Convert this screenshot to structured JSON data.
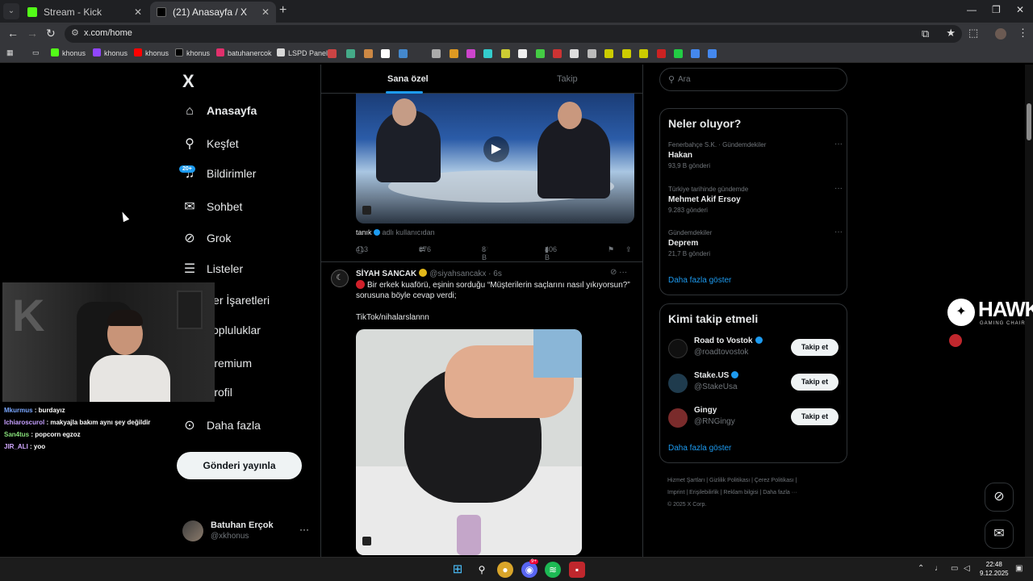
{
  "browser": {
    "tabs": [
      {
        "label": "Stream - Kick Dashboard",
        "favicon_color": "#53fc18"
      },
      {
        "label": "(21) Anasayfa / X",
        "favicon_color": "#000000"
      }
    ],
    "url": "x.com/home",
    "bookmarks": [
      "khonus",
      "khonus",
      "khonus",
      "khonus",
      "batuhanercok",
      "LSPD Panel"
    ]
  },
  "x": {
    "logo": "X",
    "nav": [
      {
        "label": "Anasayfa",
        "icon": "home-icon"
      },
      {
        "label": "Keşfet",
        "icon": "search-icon"
      },
      {
        "label": "Bildirimler",
        "icon": "bell-icon"
      },
      {
        "label": "Sohbet",
        "icon": "mail-icon"
      },
      {
        "label": "Grok",
        "icon": "grok-icon"
      },
      {
        "label": "Listeler",
        "icon": "list-icon"
      },
      {
        "label": "Yer İşaretleri",
        "icon": "bookmark-icon"
      },
      {
        "label": "Topluluklar",
        "icon": "communities-icon"
      },
      {
        "label": "Premium",
        "icon": "premium-icon"
      },
      {
        "label": "Profil",
        "icon": "profile-icon"
      },
      {
        "label": "Daha fazla",
        "icon": "more-icon"
      }
    ],
    "notif_badge": "20+",
    "post_button": "Gönderi yayınla",
    "account": {
      "name": "Batuhan Erçok",
      "handle": "@xkhonus",
      "more": "···"
    }
  },
  "timeline": {
    "tabs": [
      "Sana özel",
      "Takip"
    ],
    "post1": {
      "source_name": "tanık",
      "source_suffix": "adlı kullanıcıdan",
      "replies": "413",
      "reposts": "676",
      "likes": "8 B",
      "views": "406 B"
    },
    "post2": {
      "name": "SİYAH SANCAK",
      "handle": "@siyahsancakx · 6s",
      "text": "Bir erkek kuaförü, eşinin sorduğu “Müşterilerin saçlarını nasıl yıkıyorsun?” sorusuna böyle cevap verdi;",
      "tag": "TikTok/nihalarslannn"
    }
  },
  "sidebar": {
    "search_placeholder": "Ara",
    "trends_title": "Neler oluyor?",
    "trends": [
      {
        "context": "Fenerbahçe S.K. · Gündemdekiler",
        "title": "Hakan",
        "count": "93,9 B gönderi"
      },
      {
        "context": "Türkiye tarihinde gündemde",
        "title": "Mehmet Akif Ersoy",
        "count": "9.283 gönderi"
      },
      {
        "context": "Gündemdekiler",
        "title": "Deprem",
        "count": "21,7 B gönderi"
      }
    ],
    "trends_more": "Daha fazla göster",
    "who_title": "Kimi takip etmeli",
    "who": [
      {
        "name": "Road to Vostok",
        "handle": "@roadtovostok",
        "avatar_color": "#101010"
      },
      {
        "name": "Stake.US",
        "handle": "@StakeUsa",
        "avatar_color": "#1f3b4d"
      },
      {
        "name": "Gingy",
        "handle": "@RNGingy",
        "avatar_color": "#7a2b2b"
      }
    ],
    "follow_label": "Takip et",
    "who_more": "Daha fazla göster",
    "footer": [
      "Hizmet Şartları",
      "Gizlilik Politikası",
      "Çerez Politikası",
      "Imprint",
      "Erişilebilirlik",
      "Reklam bilgisi",
      "Daha fazla ···",
      "© 2025 X Corp."
    ]
  },
  "stream": {
    "chat": [
      {
        "user": "Mkurmus",
        "text": "burdayız",
        "color": "#7aa7ff"
      },
      {
        "user": "Ichiaroscurol",
        "text": "makyajla bakım aynı şey değildir",
        "color": "#c6a0ff"
      },
      {
        "user": "San4tus",
        "text": "popcorn egzoz",
        "color": "#88e07a"
      },
      {
        "user": "JIR_ALI",
        "text": "yoo",
        "color": "#d2a8ff"
      }
    ],
    "sponsor_brand": "HAWK",
    "sponsor_sub": "GAMING CHAIR"
  },
  "taskbar": {
    "time": "22:48",
    "date": "9.12.2025",
    "discord_badge": "9+"
  }
}
